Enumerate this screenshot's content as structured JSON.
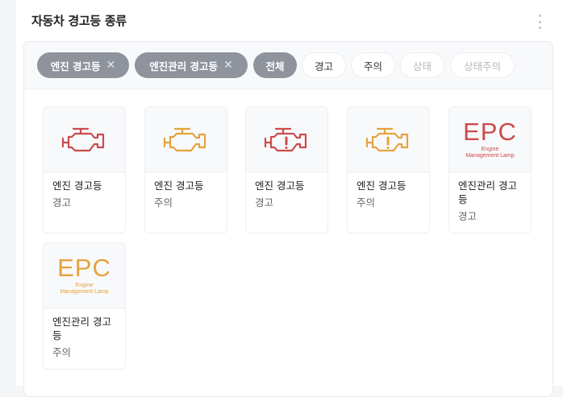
{
  "header": {
    "title": "자동차 경고등 종류"
  },
  "filters": [
    {
      "label": "엔진 경고등",
      "state": "selected",
      "removable": true
    },
    {
      "label": "엔진관리 경고등",
      "state": "selected",
      "removable": true
    },
    {
      "label": "전체",
      "state": "selected",
      "removable": false
    },
    {
      "label": "경고",
      "state": "default",
      "removable": false
    },
    {
      "label": "주의",
      "state": "default",
      "removable": false
    },
    {
      "label": "상태",
      "state": "disabled",
      "removable": false
    },
    {
      "label": "상태주의",
      "state": "disabled",
      "removable": false
    }
  ],
  "remove_glyph": "✕",
  "items": [
    {
      "name": "엔진 경고등",
      "level": "경고",
      "icon": "engine-icon",
      "color": "#cc4b4b"
    },
    {
      "name": "엔진 경고등",
      "level": "주의",
      "icon": "engine-icon",
      "color": "#e4a33c"
    },
    {
      "name": "엔진 경고등",
      "level": "경고",
      "icon": "engine-exclamation-icon",
      "color": "#cc4b4b"
    },
    {
      "name": "엔진 경고등",
      "level": "주의",
      "icon": "engine-exclamation-icon",
      "color": "#e4a33c"
    },
    {
      "name": "엔진관리 경고등",
      "level": "경고",
      "icon": "epc-icon",
      "color": "#cc4b4b",
      "epc_text": "EPC",
      "epc_sub1": "Engine",
      "epc_sub2": "Management Lamp"
    },
    {
      "name": "엔진관리 경고등",
      "level": "주의",
      "icon": "epc-icon",
      "color": "#e4a33c",
      "epc_text": "EPC",
      "epc_sub1": "Engine",
      "epc_sub2": "Management Lamp"
    }
  ]
}
